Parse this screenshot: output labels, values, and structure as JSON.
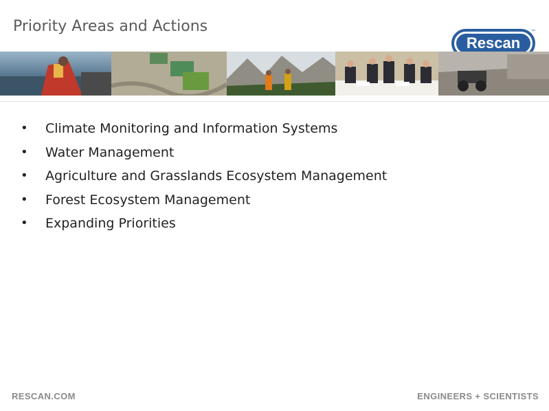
{
  "slide": {
    "title": "Priority Areas and Actions",
    "logo_text": "Rescan",
    "logo_tm": "™",
    "bullet_glyph": "•",
    "bullets": [
      "Climate Monitoring and Information Systems",
      "Water Management",
      "Agriculture and Grasslands Ecosystem Management",
      "Forest Ecosystem Management",
      "Expanding Priorities"
    ],
    "footer_left": "RESCAN.COM",
    "footer_right": "ENGINEERS + SCIENTISTS"
  },
  "colors": {
    "brand_blue": "#2a5d9f",
    "title_gray": "#5a5a5a",
    "footer_gray": "#8a8a8a"
  }
}
